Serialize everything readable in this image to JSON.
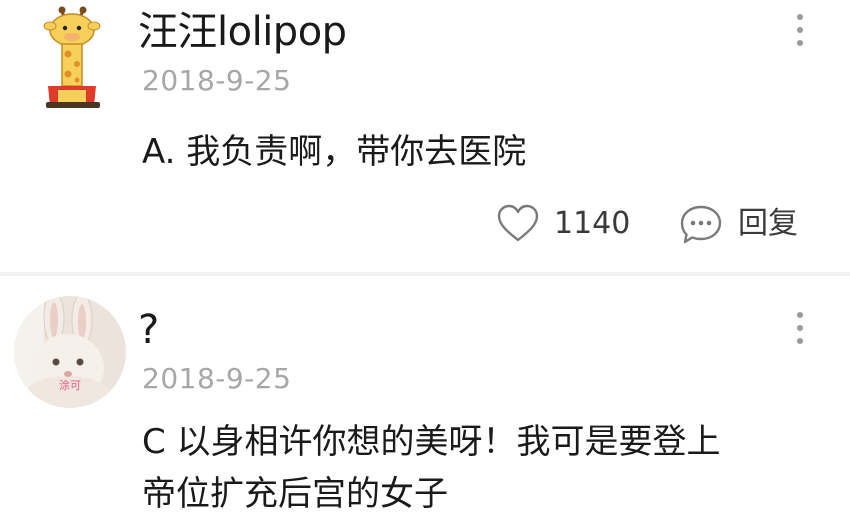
{
  "comments": [
    {
      "username": "汪汪lolipop",
      "date": "2018-9-25",
      "text_lines": [
        "A. 我负责啊，带你去医院"
      ],
      "likes": "1140",
      "reply_label": "回复",
      "avatar_icon": "giraffe-avatar-icon"
    },
    {
      "username": "?",
      "date": "2018-9-25",
      "text_lines": [
        "C 以身相许你想的美呀！我可是要登上",
        "帝位扩充后宫的女子"
      ],
      "avatar_icon": "rabbit-avatar-icon"
    }
  ],
  "icons": {
    "more": "more-vertical-icon",
    "like": "heart-icon",
    "reply": "chat-bubble-icon"
  },
  "colors": {
    "text": "#1a1a1a",
    "muted": "#a7a7a7",
    "divider": "#f2f2f2"
  }
}
